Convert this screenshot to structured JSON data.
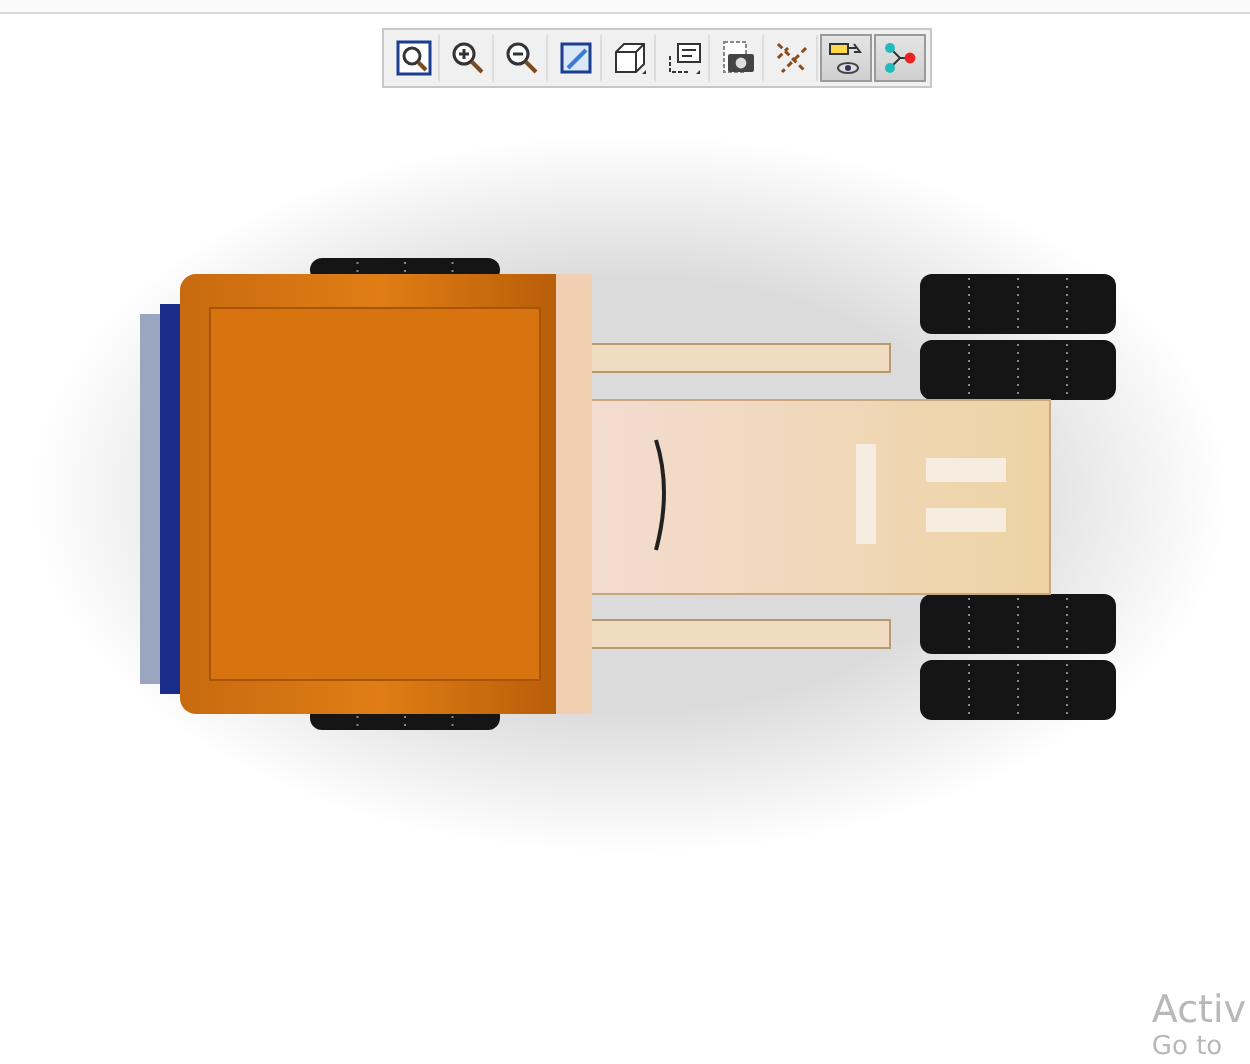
{
  "toolbar": {
    "buttons": [
      {
        "kind": "zoom-fit",
        "selected": false
      },
      {
        "kind": "zoom-in",
        "selected": false
      },
      {
        "kind": "zoom-out",
        "selected": false
      },
      {
        "kind": "shade",
        "selected": false
      },
      {
        "kind": "cube",
        "selected": false
      },
      {
        "kind": "label",
        "selected": false
      },
      {
        "kind": "camera",
        "selected": false
      },
      {
        "kind": "scatter",
        "selected": false
      },
      {
        "kind": "sign",
        "selected": true
      },
      {
        "kind": "nodes",
        "selected": true
      }
    ]
  },
  "overlay": {
    "line_1": "Activ",
    "line_2": "Go to"
  }
}
